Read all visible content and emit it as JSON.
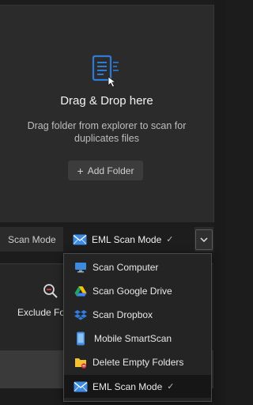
{
  "drop_zone": {
    "title": "Drag & Drop here",
    "subtitle": "Drag folder from explorer to scan for duplicates files",
    "add_folder_label": "Add Folder",
    "add_folder_icon": "+"
  },
  "scan_mode": {
    "label": "Scan Mode",
    "selected": "EML Scan Mode",
    "check_mark": "✓"
  },
  "exclude": {
    "label": "Exclude Fo"
  },
  "dropdown": {
    "items": [
      {
        "label": "Scan Computer",
        "icon": "monitor-icon"
      },
      {
        "label": "Scan Google Drive",
        "icon": "google-drive-icon"
      },
      {
        "label": "Scan Dropbox",
        "icon": "dropbox-icon"
      },
      {
        "label": "Mobile SmartScan",
        "icon": "smartphone-icon"
      },
      {
        "label": "Delete Empty Folders",
        "icon": "folder-delete-icon"
      },
      {
        "label": "EML Scan Mode",
        "icon": "envelope-icon",
        "check": "✓"
      }
    ]
  },
  "colors": {
    "accent": "#2e7bd6",
    "background": "#1c1c1c",
    "panel": "#2b2b2b"
  }
}
